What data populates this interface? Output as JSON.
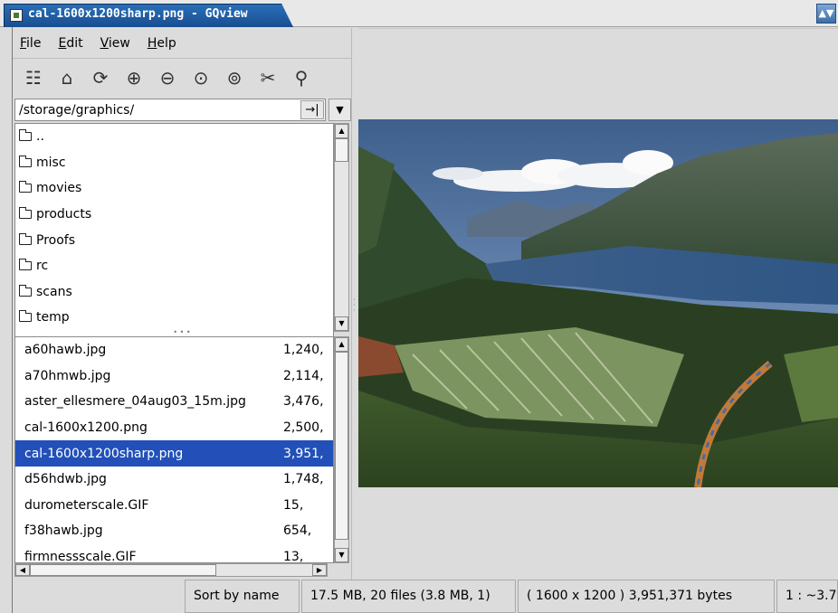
{
  "window": {
    "title": "cal-1600x1200sharp.png - GQview",
    "control_symbol": "▲▼"
  },
  "menubar": [
    {
      "label": "File",
      "accel": "F",
      "rest": "ile"
    },
    {
      "label": "Edit",
      "accel": "E",
      "rest": "dit"
    },
    {
      "label": "View",
      "accel": "V",
      "rest": "iew"
    },
    {
      "label": "Help",
      "accel": "H",
      "rest": "elp"
    }
  ],
  "toolbar": [
    {
      "name": "thumbnails-icon",
      "glyph": "☷"
    },
    {
      "name": "home-icon",
      "glyph": "⌂"
    },
    {
      "name": "refresh-icon",
      "glyph": "⟳"
    },
    {
      "name": "zoom-in-icon",
      "glyph": "⊕"
    },
    {
      "name": "zoom-out-icon",
      "glyph": "⊖"
    },
    {
      "name": "zoom-fit-icon",
      "glyph": "⊙"
    },
    {
      "name": "zoom-1to1-icon",
      "glyph": "⊚"
    },
    {
      "name": "tools-icon",
      "glyph": "✂"
    },
    {
      "name": "pin-icon",
      "glyph": "⚲"
    }
  ],
  "path": {
    "value": "/storage/graphics/",
    "go_glyph": "→|",
    "dropdown_glyph": "▼"
  },
  "directories": [
    "..",
    "misc",
    "movies",
    "products",
    "Proofs",
    "rc",
    "scans",
    "temp"
  ],
  "files": [
    {
      "name": "a60hawb.jpg",
      "size": "1,240,"
    },
    {
      "name": "a70hmwb.jpg",
      "size": "2,114,"
    },
    {
      "name": "aster_ellesmere_04aug03_15m.jpg",
      "size": "3,476,"
    },
    {
      "name": "cal-1600x1200.png",
      "size": "2,500,"
    },
    {
      "name": "cal-1600x1200sharp.png",
      "size": "3,951,",
      "selected": true
    },
    {
      "name": "d56hdwb.jpg",
      "size": "1,748,"
    },
    {
      "name": "durometerscale.GIF",
      "size": "15,"
    },
    {
      "name": "f38hawb.jpg",
      "size": "654,"
    },
    {
      "name": "firmnessscale.GIF",
      "size": "13,"
    }
  ],
  "statusbar": {
    "sort": "Sort by name",
    "totals": "17.5 MB, 20 files (3.8 MB, 1)",
    "image_info": "( 1600 x 1200 ) 3,951,371 bytes",
    "zoom": "1 : ~3.7"
  },
  "colors": {
    "selection": "#2250b8",
    "titlebar": "#2a6fb8"
  }
}
